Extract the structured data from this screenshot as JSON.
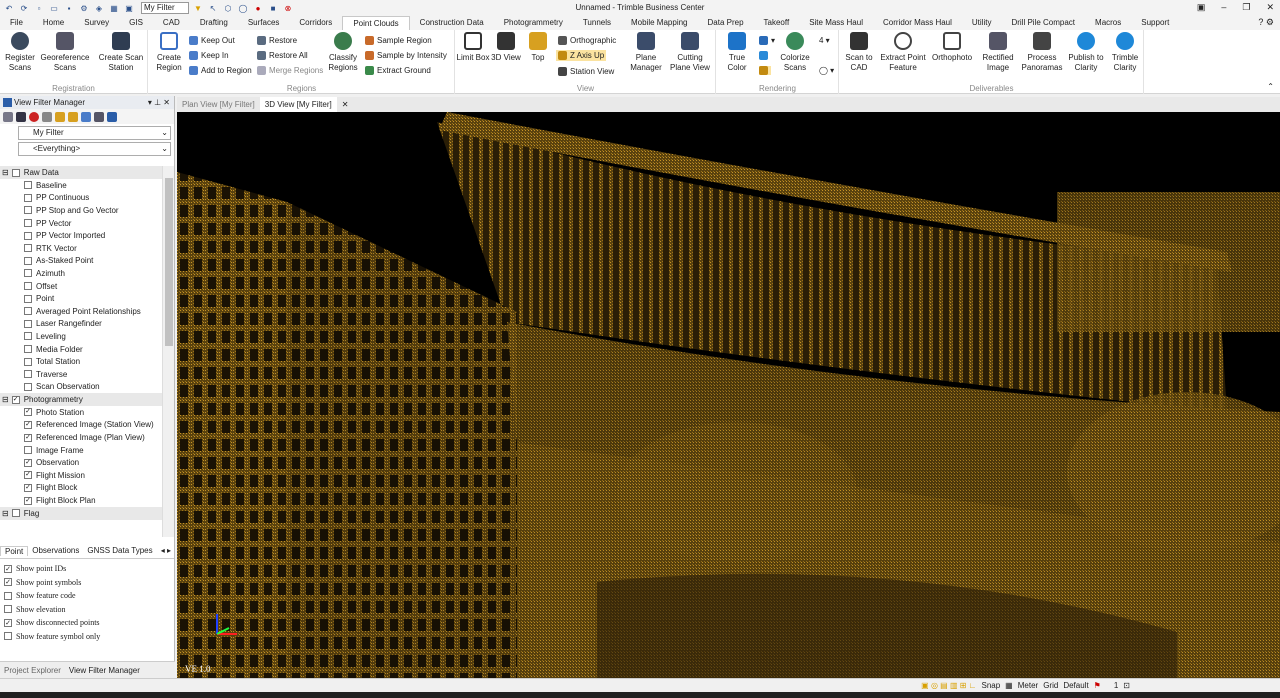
{
  "window": {
    "title": "Unnamed - Trimble Business Center",
    "filter_value": "My Filter"
  },
  "menu": {
    "tabs": [
      "File",
      "Home",
      "Survey",
      "GIS",
      "CAD",
      "Drafting",
      "Surfaces",
      "Corridors",
      "Point Clouds",
      "Construction Data",
      "Photogrammetry",
      "Tunnels",
      "Mobile Mapping",
      "Data Prep",
      "Takeoff",
      "Site Mass Haul",
      "Corridor Mass Haul",
      "Utility",
      "Drill Pile Compact",
      "Macros",
      "Support"
    ],
    "active": "Point Clouds"
  },
  "ribbon": {
    "registration": {
      "label": "Registration",
      "register": "Register Scans",
      "georeference": "Georeference Scans",
      "create_scan_station": "Create Scan Station"
    },
    "regions": {
      "label": "Regions",
      "create_region": "Create Region",
      "keep_out": "Keep Out",
      "keep_in": "Keep In",
      "add_to_region": "Add to Region",
      "restore": "Restore",
      "restore_all": "Restore All",
      "merge_regions": "Merge Regions",
      "classify_regions": "Classify Regions",
      "sample_region": "Sample Region",
      "sample_by_intensity": "Sample by Intensity",
      "extract_ground": "Extract Ground"
    },
    "view": {
      "label": "View",
      "limit_box": "Limit Box",
      "view_3d": "3D View",
      "top": "Top",
      "orthographic": "Orthographic",
      "z_axis_up": "Z Axis Up",
      "station_view": "Station View",
      "plane_manager": "Plane Manager",
      "cutting_plane_view": "Cutting Plane View"
    },
    "rendering": {
      "label": "Rendering",
      "true_color": "True Color",
      "colorize_scans": "Colorize Scans"
    },
    "deliverables": {
      "label": "Deliverables",
      "scan_to_cad": "Scan to CAD",
      "extract_point_feature": "Extract Point Feature",
      "orthophoto": "Orthophoto",
      "rectified_image": "Rectified Image",
      "process_panoramas": "Process Panoramas",
      "publish_to_clarity": "Publish to Clarity",
      "trimble_clarity": "Trimble Clarity"
    }
  },
  "panel": {
    "title": "View Filter Manager",
    "filter_combo": "My Filter",
    "type_combo": "<Everything>",
    "categories": [
      {
        "name": "Raw Data",
        "checked": false,
        "items": [
          {
            "label": "Baseline",
            "checked": false
          },
          {
            "label": "PP Continuous",
            "checked": false
          },
          {
            "label": "PP Stop and Go Vector",
            "checked": false
          },
          {
            "label": "PP Vector",
            "checked": false
          },
          {
            "label": "PP Vector Imported",
            "checked": false
          },
          {
            "label": "RTK Vector",
            "checked": false
          },
          {
            "label": "As-Staked Point",
            "checked": false
          },
          {
            "label": "Azimuth",
            "checked": false
          },
          {
            "label": "Offset",
            "checked": false
          },
          {
            "label": "Point",
            "checked": false
          },
          {
            "label": "Averaged Point Relationships",
            "checked": false
          },
          {
            "label": "Laser Rangefinder",
            "checked": false
          },
          {
            "label": "Leveling",
            "checked": false
          },
          {
            "label": "Media Folder",
            "checked": false
          },
          {
            "label": "Total Station",
            "checked": false
          },
          {
            "label": "Traverse",
            "checked": false
          },
          {
            "label": "Scan Observation",
            "checked": false
          }
        ]
      },
      {
        "name": "Photogrammetry",
        "checked": true,
        "items": [
          {
            "label": "Photo Station",
            "checked": true
          },
          {
            "label": "Referenced Image (Station View)",
            "checked": true
          },
          {
            "label": "Referenced Image (Plan View)",
            "checked": true
          },
          {
            "label": "Image Frame",
            "checked": false
          },
          {
            "label": "Observation",
            "checked": true
          },
          {
            "label": "Flight Mission",
            "checked": true
          },
          {
            "label": "Flight Block",
            "checked": true
          },
          {
            "label": "Flight Block Plan",
            "checked": true
          }
        ]
      },
      {
        "name": "Flag",
        "checked": false,
        "items": []
      }
    ],
    "tabs": [
      "Point",
      "Observations",
      "GNSS Data Types"
    ],
    "options": [
      {
        "label": "Show point IDs",
        "checked": true
      },
      {
        "label": "Show point symbols",
        "checked": true
      },
      {
        "label": "Show feature code",
        "checked": false
      },
      {
        "label": "Show elevation",
        "checked": false
      },
      {
        "label": "Show disconnected points",
        "checked": true
      },
      {
        "label": "Show feature symbol only",
        "checked": false
      }
    ],
    "bottom_tabs": [
      "Project Explorer",
      "View Filter Manager"
    ]
  },
  "views": {
    "tabs": [
      "Plan View [My Filter]",
      "3D View [My Filter]"
    ],
    "active": "3D View [My Filter]",
    "ve_label": "VE 1.0"
  },
  "status": {
    "snap": "Snap",
    "meter": "Meter",
    "grid": "Grid",
    "default": "Default",
    "page": "1"
  },
  "colors": {
    "pointcloud": "#a07418",
    "accent": "#2a5da8"
  }
}
